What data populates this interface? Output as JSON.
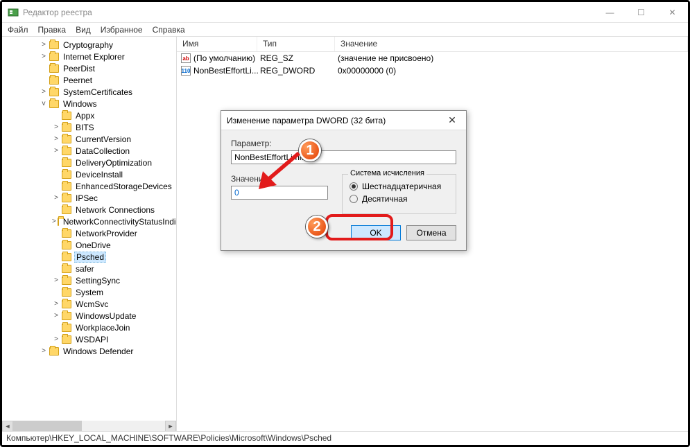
{
  "window": {
    "title": "Редактор реестра"
  },
  "menu": {
    "file": "Файл",
    "edit": "Правка",
    "view": "Вид",
    "favorites": "Избранное",
    "help": "Справка"
  },
  "tree": {
    "items": [
      {
        "indent": 3,
        "exp": ">",
        "label": "Cryptography"
      },
      {
        "indent": 3,
        "exp": ">",
        "label": "Internet Explorer"
      },
      {
        "indent": 3,
        "exp": "",
        "label": "PeerDist"
      },
      {
        "indent": 3,
        "exp": "",
        "label": "Peernet"
      },
      {
        "indent": 3,
        "exp": ">",
        "label": "SystemCertificates"
      },
      {
        "indent": 3,
        "exp": "v",
        "label": "Windows"
      },
      {
        "indent": 4,
        "exp": "",
        "label": "Appx"
      },
      {
        "indent": 4,
        "exp": ">",
        "label": "BITS"
      },
      {
        "indent": 4,
        "exp": ">",
        "label": "CurrentVersion"
      },
      {
        "indent": 4,
        "exp": ">",
        "label": "DataCollection"
      },
      {
        "indent": 4,
        "exp": "",
        "label": "DeliveryOptimization"
      },
      {
        "indent": 4,
        "exp": "",
        "label": "DeviceInstall"
      },
      {
        "indent": 4,
        "exp": "",
        "label": "EnhancedStorageDevices"
      },
      {
        "indent": 4,
        "exp": ">",
        "label": "IPSec"
      },
      {
        "indent": 4,
        "exp": "",
        "label": "Network Connections"
      },
      {
        "indent": 4,
        "exp": ">",
        "label": "NetworkConnectivityStatusIndicator"
      },
      {
        "indent": 4,
        "exp": "",
        "label": "NetworkProvider"
      },
      {
        "indent": 4,
        "exp": "",
        "label": "OneDrive"
      },
      {
        "indent": 4,
        "exp": "",
        "label": "Psched",
        "selected": true
      },
      {
        "indent": 4,
        "exp": "",
        "label": "safer"
      },
      {
        "indent": 4,
        "exp": ">",
        "label": "SettingSync"
      },
      {
        "indent": 4,
        "exp": "",
        "label": "System"
      },
      {
        "indent": 4,
        "exp": ">",
        "label": "WcmSvc"
      },
      {
        "indent": 4,
        "exp": ">",
        "label": "WindowsUpdate"
      },
      {
        "indent": 4,
        "exp": "",
        "label": "WorkplaceJoin"
      },
      {
        "indent": 4,
        "exp": ">",
        "label": "WSDAPI"
      },
      {
        "indent": 3,
        "exp": ">",
        "label": "Windows Defender"
      }
    ]
  },
  "list": {
    "headers": {
      "name": "Имя",
      "type": "Тип",
      "value": "Значение"
    },
    "rows": [
      {
        "icon": "sz",
        "name": "(По умолчанию)",
        "type": "REG_SZ",
        "value": "(значение не присвоено)"
      },
      {
        "icon": "dw",
        "name": "NonBestEffortLi...",
        "type": "REG_DWORD",
        "value": "0x00000000 (0)"
      }
    ]
  },
  "dialog": {
    "title": "Изменение параметра DWORD (32 бита)",
    "param_label": "Параметр:",
    "param_value": "NonBestEffortLimit",
    "value_label": "Значение:",
    "value_input": "0",
    "base_legend": "Система исчисления",
    "base_hex": "Шестнадцатеричная",
    "base_dec": "Десятичная",
    "ok": "OK",
    "cancel": "Отмена"
  },
  "callouts": {
    "one": "1",
    "two": "2"
  },
  "statusbar": "Компьютер\\HKEY_LOCAL_MACHINE\\SOFTWARE\\Policies\\Microsoft\\Windows\\Psched"
}
